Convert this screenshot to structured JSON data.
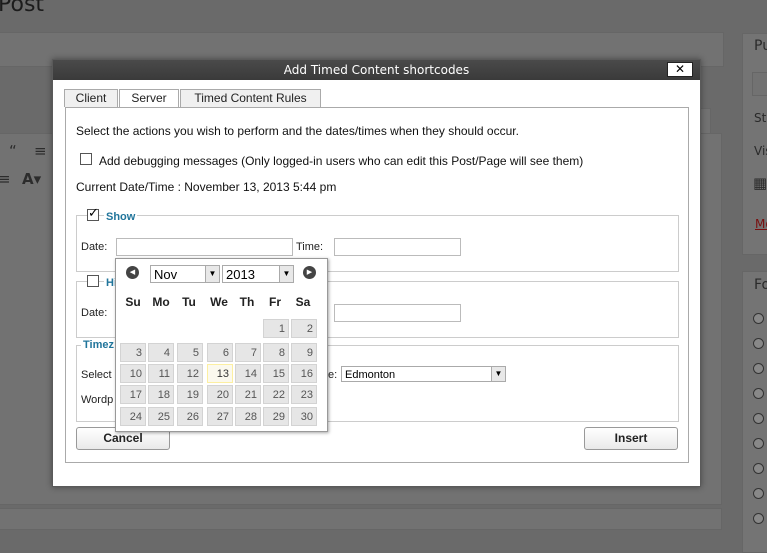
{
  "background": {
    "page_title": "Post",
    "sidebar_labels": [
      "Pu",
      "Sta",
      "Vis",
      "Mo",
      "Fo"
    ]
  },
  "dialog": {
    "title": "Add Timed Content shortcodes",
    "close_label": "✕",
    "tabs": [
      {
        "label": "Client"
      },
      {
        "label": "Server"
      },
      {
        "label": "Timed Content Rules"
      }
    ],
    "intro": "Select the actions you wish to perform and the dates/times when they should occur.",
    "debug_label": "Add debugging messages (Only logged-in users who can edit this Post/Page will see them)",
    "current_datetime": "Current Date/Time : November 13, 2013 5:44 pm",
    "show_legend": "Show",
    "hide_legend": "Hi",
    "timezone_legend": "Timez",
    "date_label": "Date:",
    "time_label": "Time:",
    "select_label": "Select",
    "timezone_suffix": "e:",
    "timezone_value": "Edmonton",
    "wordpress_label": "Wordp",
    "cancel_label": "Cancel",
    "insert_label": "Insert"
  },
  "datepicker": {
    "month": "Nov",
    "year": "2013",
    "weekdays": [
      "Su",
      "Mo",
      "Tu",
      "We",
      "Th",
      "Fr",
      "Sa"
    ],
    "weeks": [
      [
        "",
        "",
        "",
        "",
        "",
        "1",
        "2"
      ],
      [
        "3",
        "4",
        "5",
        "6",
        "7",
        "8",
        "9"
      ],
      [
        "10",
        "11",
        "12",
        "13",
        "14",
        "15",
        "16"
      ],
      [
        "17",
        "18",
        "19",
        "20",
        "21",
        "22",
        "23"
      ],
      [
        "24",
        "25",
        "26",
        "27",
        "28",
        "29",
        "30"
      ]
    ],
    "today": "13"
  },
  "icons": {
    "prev": "triangle-left-icon",
    "next": "triangle-right-icon",
    "close": "close-icon"
  }
}
